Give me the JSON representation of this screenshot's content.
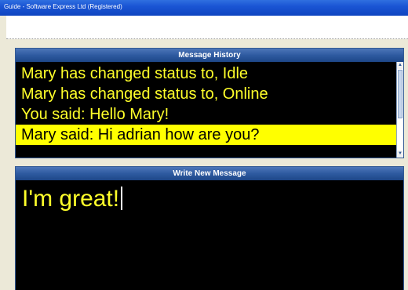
{
  "window": {
    "title": "Guide - Software Express Ltd (Registered)"
  },
  "history": {
    "header": "Message History",
    "messages": [
      "Mary has changed status to, Idle",
      "Mary has changed status to, Online",
      "You said: Hello Mary!",
      "Mary said: Hi adrian how are you?"
    ],
    "selected_index": 3
  },
  "compose": {
    "header": "Write New Message",
    "text": "I'm great!"
  },
  "colors": {
    "text_yellow": "#ffff2a",
    "highlight": "#ffff00",
    "panel_header": "#2e5aa0",
    "titlebar": "#1a55d4"
  }
}
